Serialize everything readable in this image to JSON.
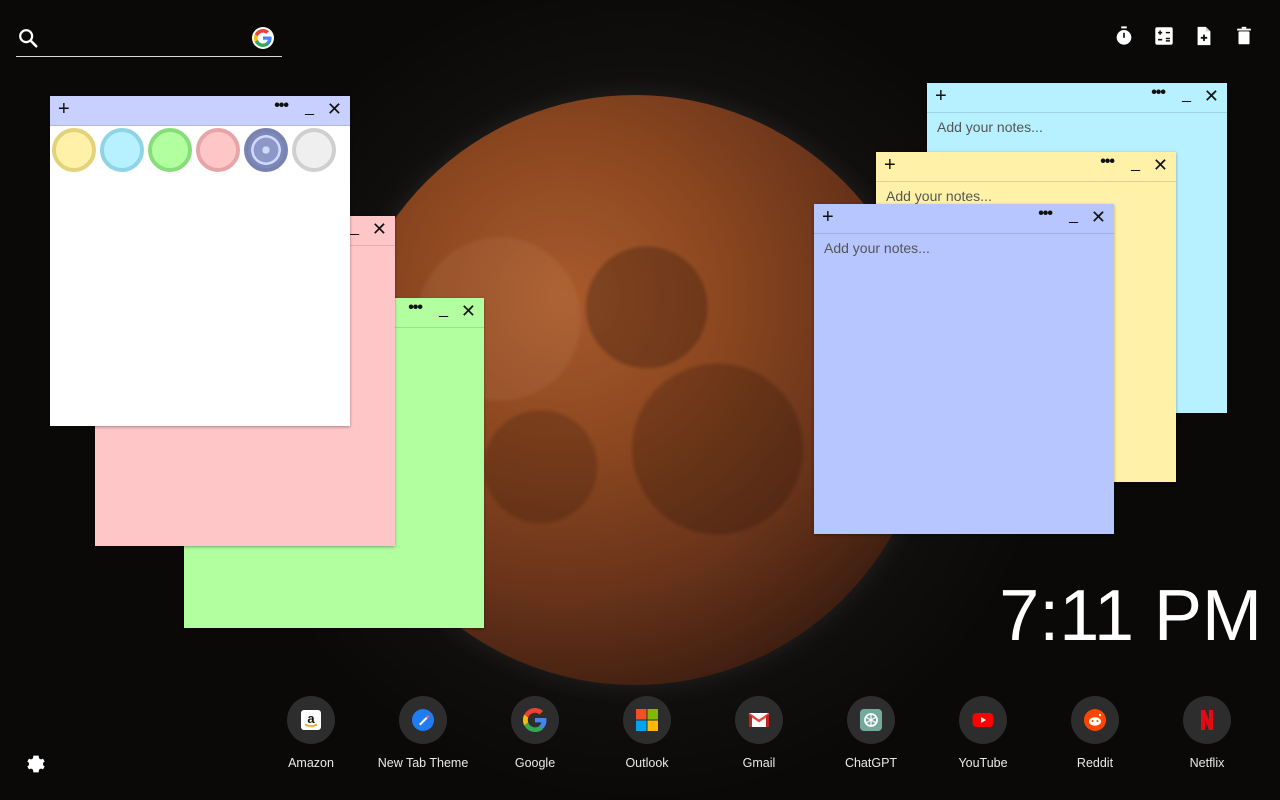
{
  "search": {
    "value": "",
    "placeholder": ""
  },
  "top_actions": {
    "icons": [
      "stopwatch-icon",
      "calculator-icon",
      "note-add-icon",
      "trash-icon"
    ]
  },
  "notes": {
    "placeholder": "Add your notes...",
    "palette": {
      "yellow": "#fff2a8",
      "cyan": "#b7f0ff",
      "green": "#b1ff9f",
      "pink": "#ffc6c8",
      "blue": "#b8c6ff",
      "white": "#ffffff"
    },
    "plus_symbol": "+",
    "more_symbol": "•••",
    "minimize_symbol": "_",
    "close_symbol": "✕"
  },
  "clock": {
    "time": "7:11 PM"
  },
  "shortcuts": [
    {
      "label": "Amazon"
    },
    {
      "label": "New Tab Theme"
    },
    {
      "label": "Google"
    },
    {
      "label": "Outlook"
    },
    {
      "label": "Gmail"
    },
    {
      "label": "ChatGPT"
    },
    {
      "label": "YouTube"
    },
    {
      "label": "Reddit"
    },
    {
      "label": "Netflix"
    }
  ]
}
